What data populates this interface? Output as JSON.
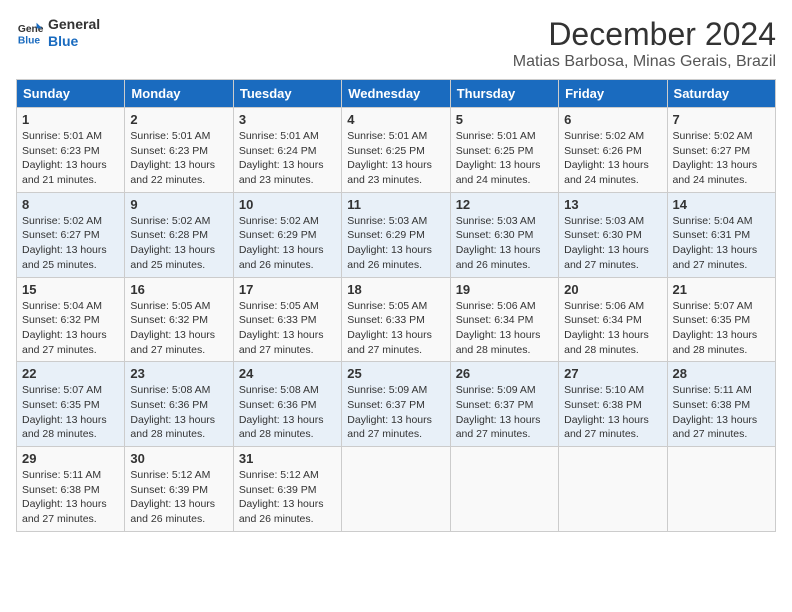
{
  "logo": {
    "line1": "General",
    "line2": "Blue"
  },
  "title": "December 2024",
  "location": "Matias Barbosa, Minas Gerais, Brazil",
  "days_header": [
    "Sunday",
    "Monday",
    "Tuesday",
    "Wednesday",
    "Thursday",
    "Friday",
    "Saturday"
  ],
  "weeks": [
    [
      {
        "day": "1",
        "info": "Sunrise: 5:01 AM\nSunset: 6:23 PM\nDaylight: 13 hours\nand 21 minutes."
      },
      {
        "day": "2",
        "info": "Sunrise: 5:01 AM\nSunset: 6:23 PM\nDaylight: 13 hours\nand 22 minutes."
      },
      {
        "day": "3",
        "info": "Sunrise: 5:01 AM\nSunset: 6:24 PM\nDaylight: 13 hours\nand 23 minutes."
      },
      {
        "day": "4",
        "info": "Sunrise: 5:01 AM\nSunset: 6:25 PM\nDaylight: 13 hours\nand 23 minutes."
      },
      {
        "day": "5",
        "info": "Sunrise: 5:01 AM\nSunset: 6:25 PM\nDaylight: 13 hours\nand 24 minutes."
      },
      {
        "day": "6",
        "info": "Sunrise: 5:02 AM\nSunset: 6:26 PM\nDaylight: 13 hours\nand 24 minutes."
      },
      {
        "day": "7",
        "info": "Sunrise: 5:02 AM\nSunset: 6:27 PM\nDaylight: 13 hours\nand 24 minutes."
      }
    ],
    [
      {
        "day": "8",
        "info": "Sunrise: 5:02 AM\nSunset: 6:27 PM\nDaylight: 13 hours\nand 25 minutes."
      },
      {
        "day": "9",
        "info": "Sunrise: 5:02 AM\nSunset: 6:28 PM\nDaylight: 13 hours\nand 25 minutes."
      },
      {
        "day": "10",
        "info": "Sunrise: 5:02 AM\nSunset: 6:29 PM\nDaylight: 13 hours\nand 26 minutes."
      },
      {
        "day": "11",
        "info": "Sunrise: 5:03 AM\nSunset: 6:29 PM\nDaylight: 13 hours\nand 26 minutes."
      },
      {
        "day": "12",
        "info": "Sunrise: 5:03 AM\nSunset: 6:30 PM\nDaylight: 13 hours\nand 26 minutes."
      },
      {
        "day": "13",
        "info": "Sunrise: 5:03 AM\nSunset: 6:30 PM\nDaylight: 13 hours\nand 27 minutes."
      },
      {
        "day": "14",
        "info": "Sunrise: 5:04 AM\nSunset: 6:31 PM\nDaylight: 13 hours\nand 27 minutes."
      }
    ],
    [
      {
        "day": "15",
        "info": "Sunrise: 5:04 AM\nSunset: 6:32 PM\nDaylight: 13 hours\nand 27 minutes."
      },
      {
        "day": "16",
        "info": "Sunrise: 5:05 AM\nSunset: 6:32 PM\nDaylight: 13 hours\nand 27 minutes."
      },
      {
        "day": "17",
        "info": "Sunrise: 5:05 AM\nSunset: 6:33 PM\nDaylight: 13 hours\nand 27 minutes."
      },
      {
        "day": "18",
        "info": "Sunrise: 5:05 AM\nSunset: 6:33 PM\nDaylight: 13 hours\nand 27 minutes."
      },
      {
        "day": "19",
        "info": "Sunrise: 5:06 AM\nSunset: 6:34 PM\nDaylight: 13 hours\nand 28 minutes."
      },
      {
        "day": "20",
        "info": "Sunrise: 5:06 AM\nSunset: 6:34 PM\nDaylight: 13 hours\nand 28 minutes."
      },
      {
        "day": "21",
        "info": "Sunrise: 5:07 AM\nSunset: 6:35 PM\nDaylight: 13 hours\nand 28 minutes."
      }
    ],
    [
      {
        "day": "22",
        "info": "Sunrise: 5:07 AM\nSunset: 6:35 PM\nDaylight: 13 hours\nand 28 minutes."
      },
      {
        "day": "23",
        "info": "Sunrise: 5:08 AM\nSunset: 6:36 PM\nDaylight: 13 hours\nand 28 minutes."
      },
      {
        "day": "24",
        "info": "Sunrise: 5:08 AM\nSunset: 6:36 PM\nDaylight: 13 hours\nand 28 minutes."
      },
      {
        "day": "25",
        "info": "Sunrise: 5:09 AM\nSunset: 6:37 PM\nDaylight: 13 hours\nand 27 minutes."
      },
      {
        "day": "26",
        "info": "Sunrise: 5:09 AM\nSunset: 6:37 PM\nDaylight: 13 hours\nand 27 minutes."
      },
      {
        "day": "27",
        "info": "Sunrise: 5:10 AM\nSunset: 6:38 PM\nDaylight: 13 hours\nand 27 minutes."
      },
      {
        "day": "28",
        "info": "Sunrise: 5:11 AM\nSunset: 6:38 PM\nDaylight: 13 hours\nand 27 minutes."
      }
    ],
    [
      {
        "day": "29",
        "info": "Sunrise: 5:11 AM\nSunset: 6:38 PM\nDaylight: 13 hours\nand 27 minutes."
      },
      {
        "day": "30",
        "info": "Sunrise: 5:12 AM\nSunset: 6:39 PM\nDaylight: 13 hours\nand 26 minutes."
      },
      {
        "day": "31",
        "info": "Sunrise: 5:12 AM\nSunset: 6:39 PM\nDaylight: 13 hours\nand 26 minutes."
      },
      {
        "day": "",
        "info": ""
      },
      {
        "day": "",
        "info": ""
      },
      {
        "day": "",
        "info": ""
      },
      {
        "day": "",
        "info": ""
      }
    ]
  ]
}
